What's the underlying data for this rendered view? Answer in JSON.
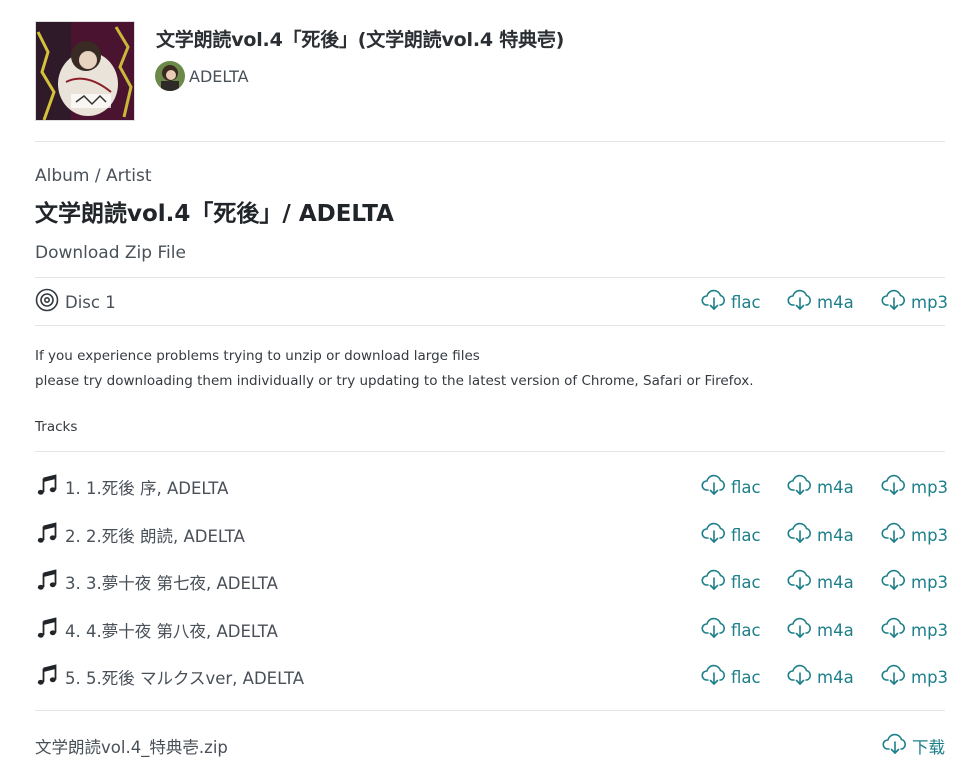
{
  "header": {
    "title": "文学朗読vol.4「死後」(文学朗読vol.4 特典壱)",
    "artist": "ADELTA"
  },
  "album": {
    "section_label": "Album / Artist",
    "title": "文学朗読vol.4「死後」/ ADELTA",
    "download_zip_label": "Download Zip File"
  },
  "disc": {
    "label": "Disc 1",
    "formats": [
      "flac",
      "m4a",
      "mp3"
    ]
  },
  "note": {
    "line1": "If you experience problems trying to unzip or download large files",
    "line2": "please try downloading them individually or try updating to the latest version of Chrome, Safari or Firefox."
  },
  "tracks_label": "Tracks",
  "tracks": [
    {
      "label": "1. 1.死後 序, ADELTA"
    },
    {
      "label": "2. 2.死後 朗読, ADELTA"
    },
    {
      "label": "3. 3.夢十夜 第七夜, ADELTA"
    },
    {
      "label": "4. 4.夢十夜 第八夜, ADELTA"
    },
    {
      "label": "5. 5.死後 マルクスver, ADELTA"
    }
  ],
  "formats": {
    "flac": "flac",
    "m4a": "m4a",
    "mp3": "mp3"
  },
  "extra_file": {
    "name": "文学朗読vol.4_特典壱.zip",
    "download_label": "下载"
  },
  "colors": {
    "accent": "#1c7f89",
    "text": "#495057",
    "divider": "#e3e5e7"
  }
}
